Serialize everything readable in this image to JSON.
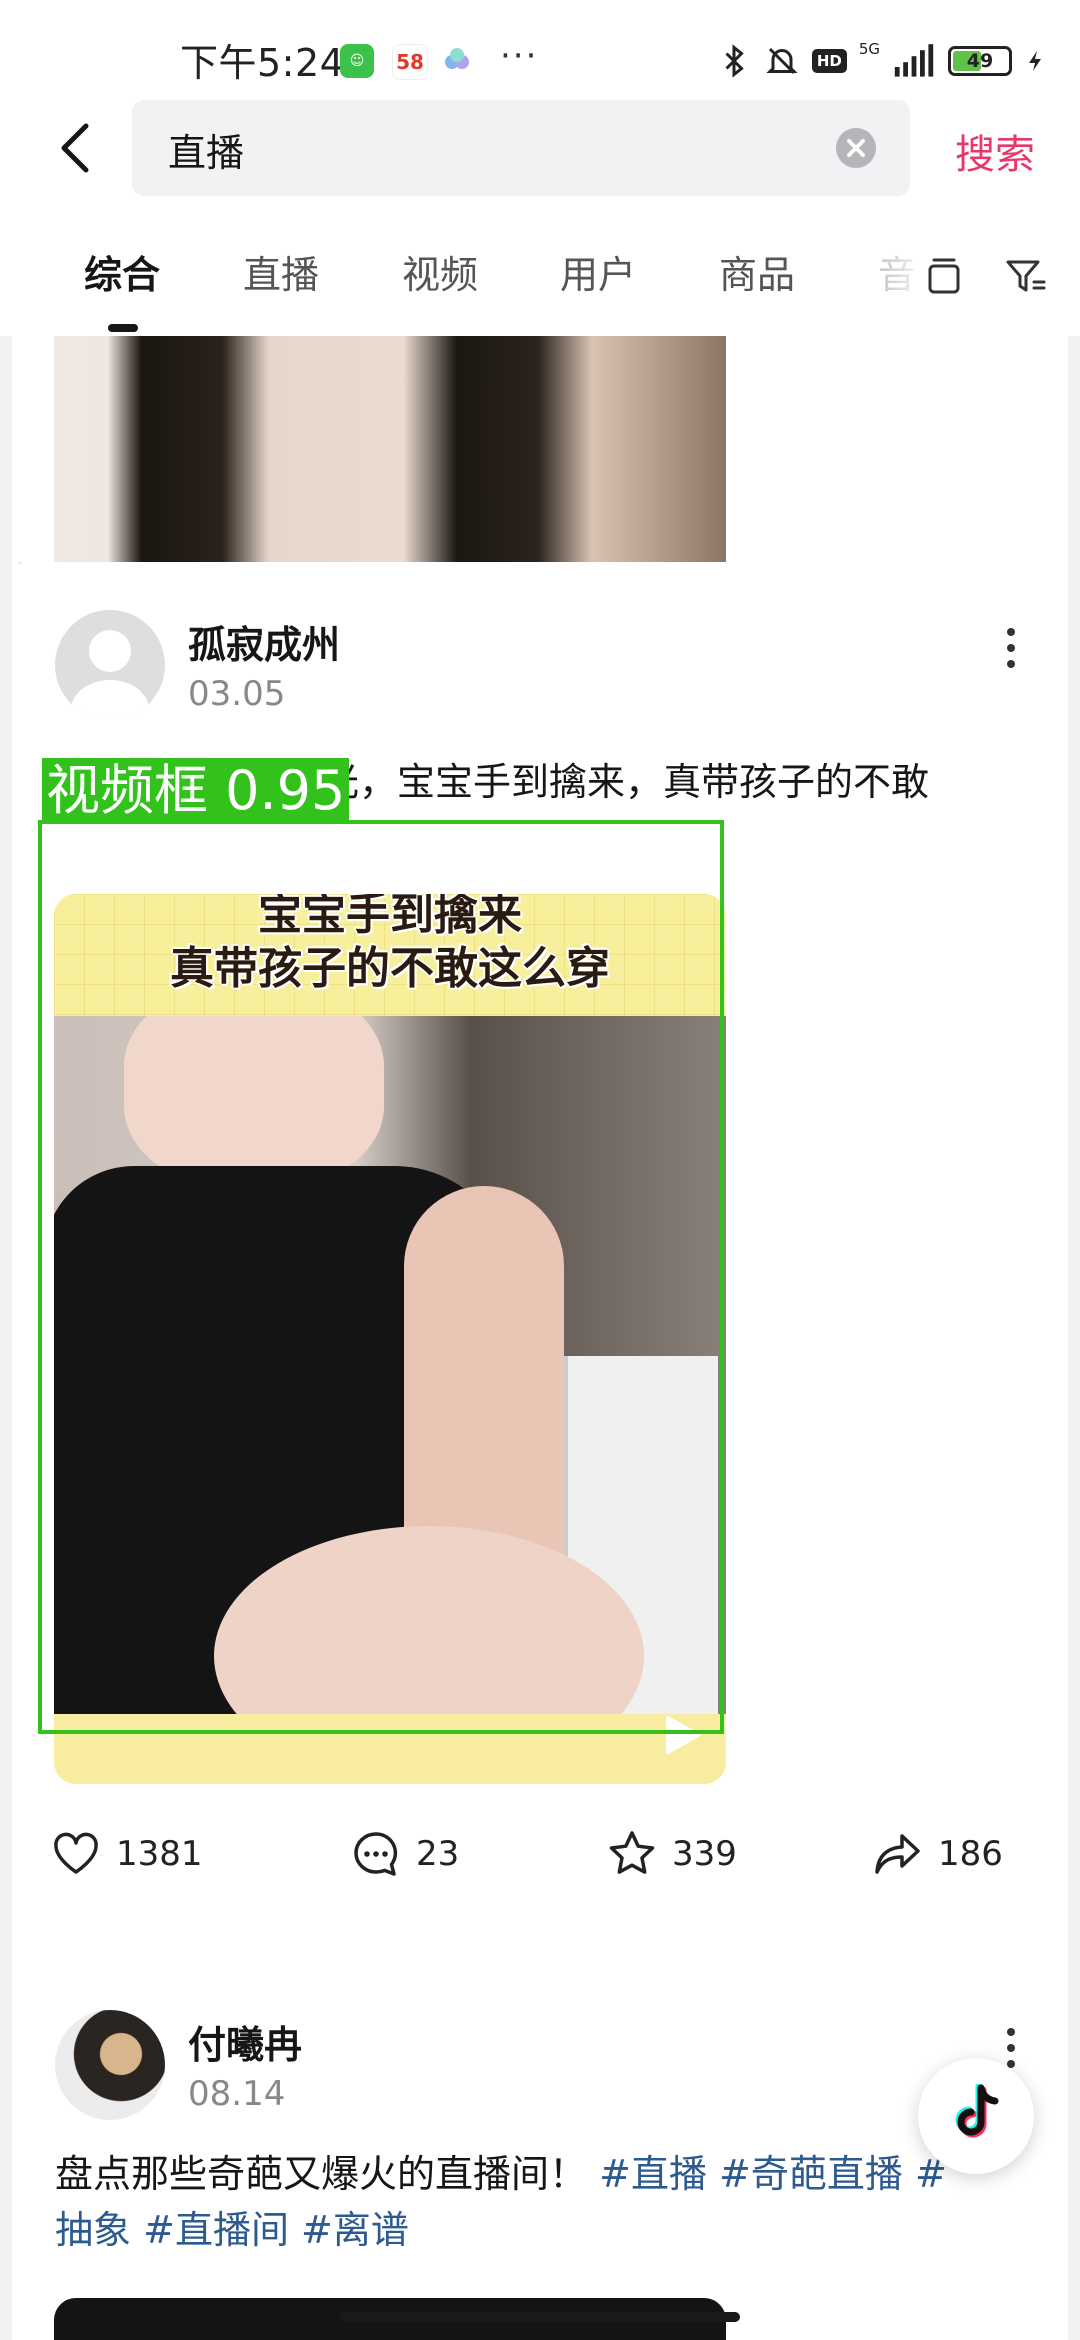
{
  "status_bar": {
    "time": "下午5:24",
    "app_58_label": "58",
    "more": "···",
    "hd": "HD",
    "network": "5G",
    "battery": "49"
  },
  "search": {
    "query": "直播",
    "search_label": "搜索"
  },
  "tabs": [
    {
      "label": "综合",
      "active": true
    },
    {
      "label": "直播",
      "active": false
    },
    {
      "label": "视频",
      "active": false
    },
    {
      "label": "用户",
      "active": false
    },
    {
      "label": "商品",
      "active": false
    },
    {
      "label": "音",
      "active": false
    }
  ],
  "posts": [
    {
      "author": "孤寂成州",
      "date": "03.05",
      "text": "美女直播差点走光，宝宝手到擒来，真带孩子的不敢",
      "video_caption_1": "宝宝手到擒来",
      "video_caption_2": "真带孩子的不敢这么穿",
      "detection_label": "视频框 0.95",
      "likes": "1381",
      "comments": "23",
      "favorites": "339",
      "shares": "186"
    },
    {
      "author": "付曦冉",
      "date": "08.14",
      "text": "盘点那些奇葩又爆火的直播间！",
      "hashtags": [
        "#直播",
        "#奇葩直播",
        "#抽象",
        "#直播间",
        "#离谱"
      ],
      "wrapped_hashtag_part_1": "#",
      "wrapped_hashtag_part_2": "抽象"
    }
  ],
  "colors": {
    "accent": "#e8386a",
    "hashtag": "#2d5a8f",
    "detection": "#33c21c"
  }
}
